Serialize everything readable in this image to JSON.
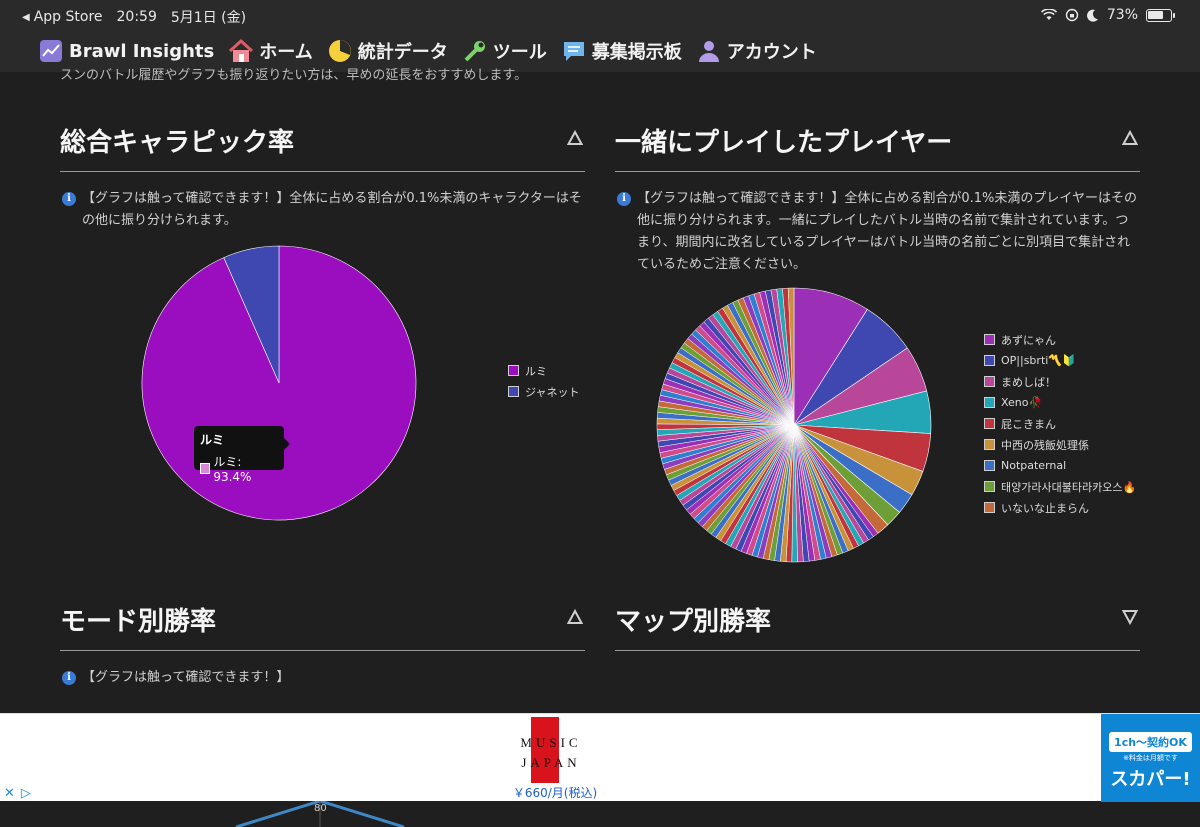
{
  "status_bar": {
    "back_app": "App Store",
    "time": "20:59",
    "date": "5月1日 (金)",
    "battery": "73%",
    "battery_level": 0.73
  },
  "nav": {
    "brand": "Brawl Insights",
    "items": [
      {
        "label": "ホーム",
        "icon": "house-icon"
      },
      {
        "label": "統計データ",
        "icon": "pie-chart-icon"
      },
      {
        "label": "ツール",
        "icon": "wrench-icon"
      },
      {
        "label": "募集掲示板",
        "icon": "chat-icon"
      },
      {
        "label": "アカウント",
        "icon": "user-icon"
      }
    ]
  },
  "cutoff_text": "スンのバトル履歴やグラフも振り返りたい方は、早めの延長をおすすめします。",
  "sections": {
    "pick_rate": {
      "title": "総合キャラピック率",
      "toggle": "collapse",
      "note": "【グラフは触って確認できます！】全体に占める割合が0.1%未満のキャラクターはその他に振り分けられます。",
      "tooltip": {
        "title": "ルミ",
        "body": "ルミ: 93.4%"
      }
    },
    "teammates": {
      "title": "一緒にプレイしたプレイヤー",
      "toggle": "collapse",
      "note": "【グラフは触って確認できます！】全体に占める割合が0.1%未満のプレイヤーはその他に振り分けられます。一緒にプレイしたバトル当時の名前で集計されています。つまり、期間内に改名しているプレイヤーはバトル当時の名前ごとに別項目で集計されているためご注意ください。"
    },
    "mode_winrate": {
      "title": "モード別勝率",
      "toggle": "collapse",
      "note": "【グラフは触って確認できます！】"
    },
    "map_winrate": {
      "title": "マップ別勝率",
      "toggle": "expand"
    }
  },
  "chart_data": [
    {
      "type": "pie",
      "labels": [
        "ルミ",
        "ジャネット"
      ],
      "values": [
        93.4,
        6.6
      ],
      "colors": [
        "#9b0ec0",
        "#3f48b0"
      ]
    },
    {
      "type": "pie",
      "labels": [
        "あずにゃん",
        "OP||sbrti〽️🔰",
        "まめしば！",
        "Xeno🥀",
        "屁こきまん",
        "中西の残飯処理係",
        "Notpaternal",
        "태양가라사대불타라카오스🔥",
        "いないな止まらん"
      ],
      "values": [
        9.0,
        6.5,
        5.5,
        5.0,
        4.5,
        3.0,
        2.5,
        2.0,
        1.5
      ],
      "colors": [
        "#9b2fb5",
        "#3f48b0",
        "#b8479a",
        "#23a6b6",
        "#c0343e",
        "#c8923a",
        "#3b6fc7",
        "#6e9e37",
        "#c46a3a"
      ],
      "legend_position": "right"
    }
  ],
  "mode_chart": {
    "tick": "80"
  },
  "ad": {
    "logo_line1": "MUSIC",
    "logo_line2": "JAPAN",
    "price": "￥660/月(税込)",
    "right_line1": "1ch〜契約OK",
    "right_line2": "※料金は月額です",
    "right_brand": "スカパー!"
  }
}
